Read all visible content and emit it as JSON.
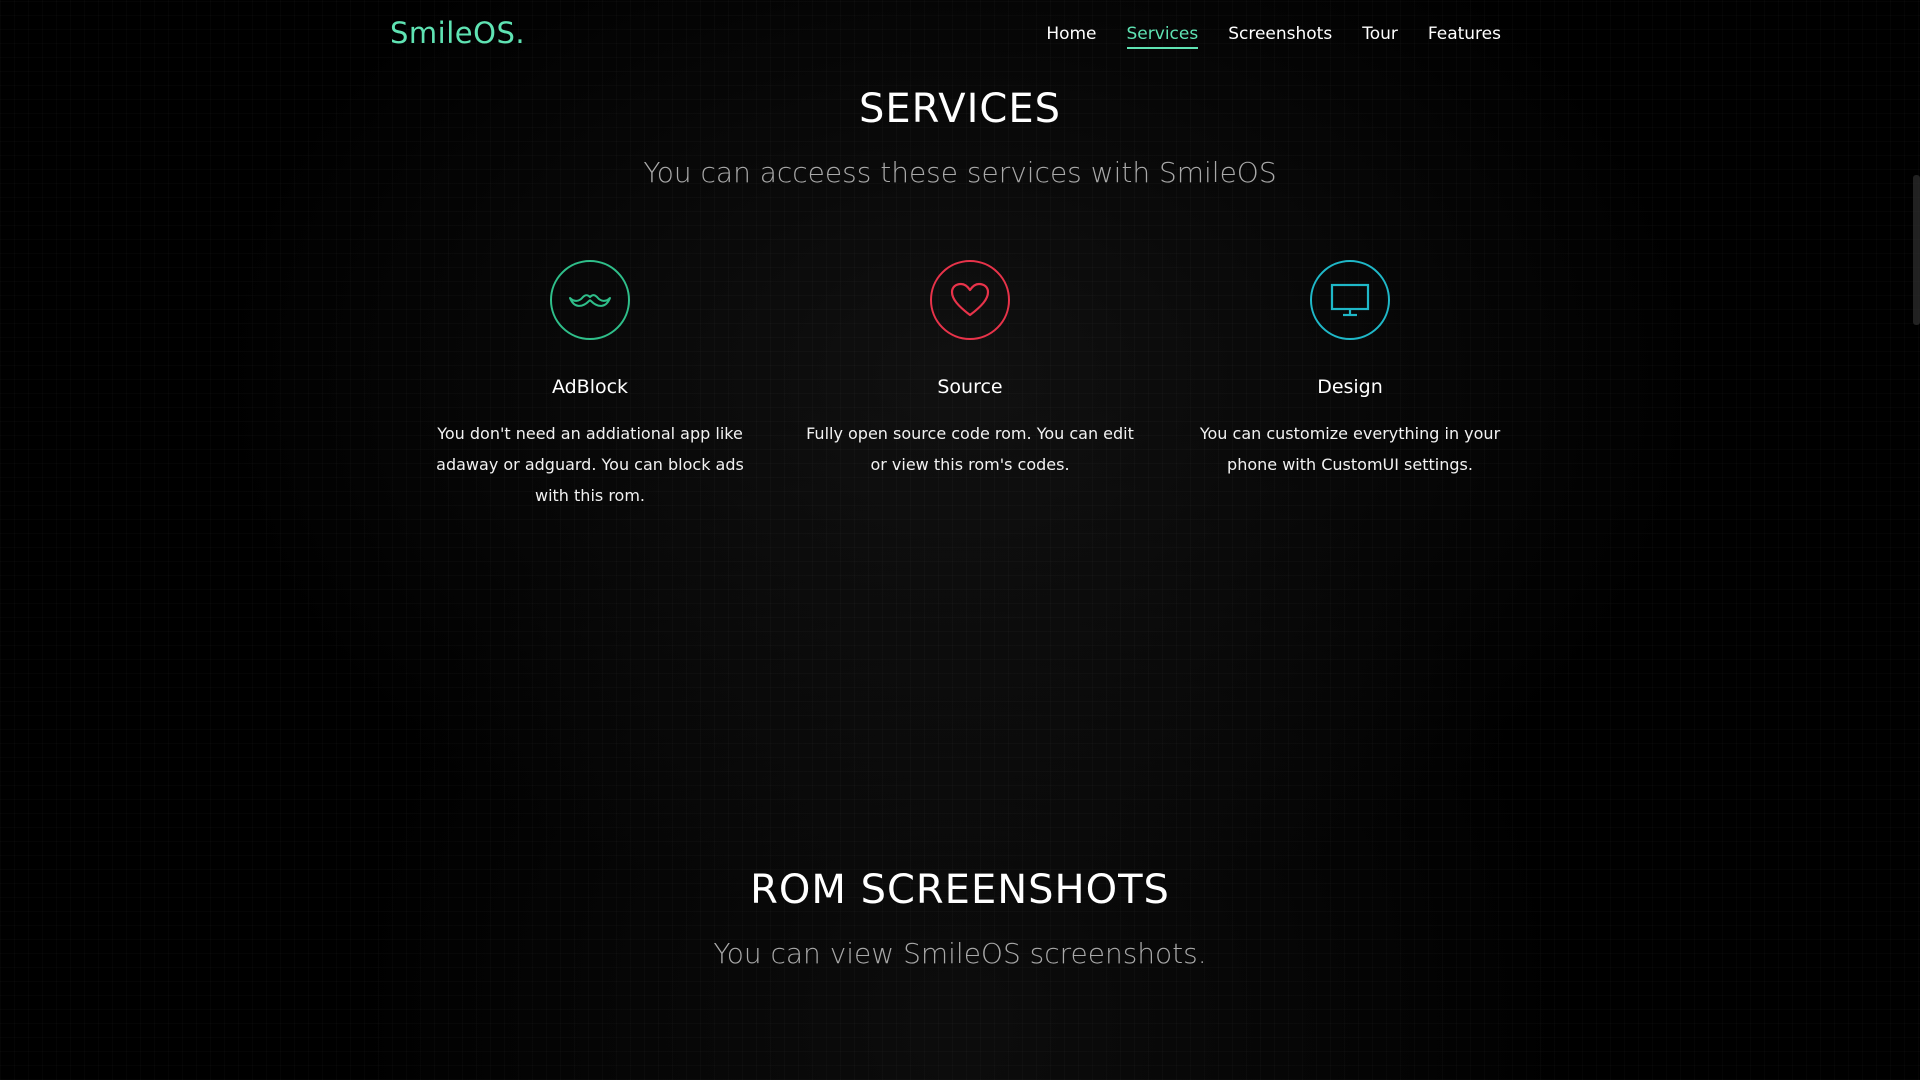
{
  "nav": {
    "brand": "SmileOS.",
    "links": [
      {
        "label": "Home",
        "active": false
      },
      {
        "label": "Services",
        "active": true
      },
      {
        "label": "Screenshots",
        "active": false
      },
      {
        "label": "Tour",
        "active": false
      },
      {
        "label": "Features",
        "active": false
      }
    ]
  },
  "services": {
    "title": "SERVICES",
    "subtitle": "You can acceess these services with SmileOS",
    "cards": [
      {
        "icon": "mustache-icon",
        "color": "#2fbf8a",
        "title": "AdBlock",
        "text": "You don't need an addiational app like adaway or adguard. You can block ads with this rom."
      },
      {
        "icon": "heart-icon",
        "color": "#e8334a",
        "title": "Source",
        "text": "Fully open source code rom. You can edit or view this rom's codes."
      },
      {
        "icon": "monitor-icon",
        "color": "#1fb8c8",
        "title": "Design",
        "text": "You can customize everything in your phone with CustomUI settings."
      }
    ]
  },
  "screenshots": {
    "title": "ROM SCREENSHOTS",
    "subtitle": "You can view SmileOS screenshots."
  },
  "colors": {
    "accent": "#5fe3b3",
    "background": "#000000"
  }
}
